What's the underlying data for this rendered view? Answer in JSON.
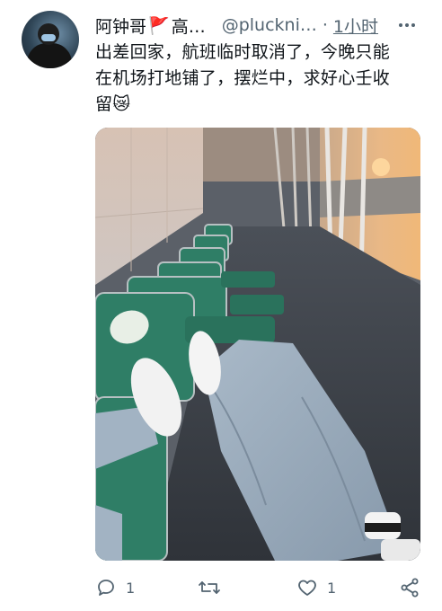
{
  "tweet": {
    "display_name": "阿钟哥",
    "name_suffix": "高…",
    "handle": "@pluckni…",
    "separator": "·",
    "time": "1小时",
    "text_line1": "出差回家，航班临时取消了，今晚只能",
    "text_line2": "在机场打地铺了，摆烂中，求好心壬收",
    "text_line3": "留😿",
    "flag_emoji": "🚩"
  },
  "actions": {
    "reply_count": "1",
    "retweet_count": "",
    "like_count": "1"
  },
  "icons": {
    "more": "more-dots-icon",
    "reply": "reply-icon",
    "retweet": "retweet-icon",
    "like": "heart-icon",
    "share": "share-icon"
  },
  "colors": {
    "secondary_text": "#536471",
    "primary_text": "#0f1419"
  }
}
